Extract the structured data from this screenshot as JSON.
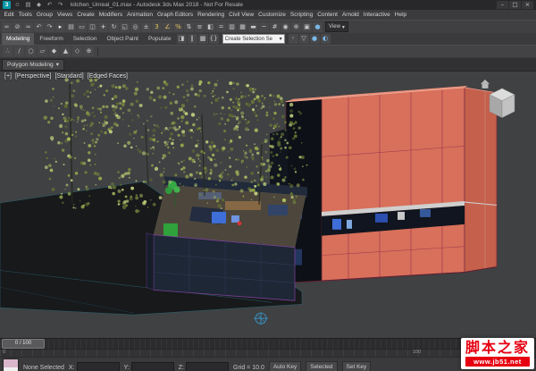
{
  "window": {
    "title": "kitchen_Unreal_01.max - Autodesk 3ds Max 2018 - Not For Resale",
    "logo": "3",
    "minimize": "–",
    "maximize": "□",
    "close": "×",
    "quick_icons": [
      {
        "name": "new-scene-icon",
        "glyph": "▫"
      },
      {
        "name": "open-file-icon",
        "glyph": "▤"
      },
      {
        "name": "save-file-icon",
        "glyph": "◆"
      },
      {
        "name": "undo-quick-icon",
        "glyph": "↶"
      },
      {
        "name": "redo-quick-icon",
        "glyph": "↷"
      }
    ]
  },
  "menu": {
    "items": [
      "Edit",
      "Tools",
      "Group",
      "Views",
      "Create",
      "Modifiers",
      "Animation",
      "Graph Editors",
      "Rendering",
      "Civil View",
      "Customize",
      "Scripting",
      "Content",
      "Arnold",
      "Interactive",
      "Help"
    ]
  },
  "toolbar": {
    "coord_dropdown": "View",
    "selection_set_value": "Create Selection Se",
    "icons": [
      {
        "name": "select-link-icon",
        "glyph": "∞"
      },
      {
        "name": "unlink-icon",
        "glyph": "⊘"
      },
      {
        "name": "bind-spacewarp-icon",
        "glyph": "≈"
      },
      {
        "name": "undo-icon",
        "glyph": "↶"
      },
      {
        "name": "redo-icon",
        "glyph": "↷"
      },
      {
        "name": "select-object-icon",
        "glyph": "▸",
        "color": "#f0f0f0"
      },
      {
        "name": "select-by-name-icon",
        "glyph": "▤"
      },
      {
        "name": "rectangular-region-icon",
        "glyph": "▭"
      },
      {
        "name": "window-crossing-icon",
        "glyph": "◫"
      },
      {
        "name": "select-move-icon",
        "glyph": "+",
        "color": "#e8e8e8"
      },
      {
        "name": "select-rotate-icon",
        "glyph": "↻"
      },
      {
        "name": "select-scale-icon",
        "glyph": "◱"
      },
      {
        "name": "pivot-point-icon",
        "glyph": "◎"
      },
      {
        "name": "select-manipulate-icon",
        "glyph": "±"
      },
      {
        "name": "snap-toggle-icon",
        "glyph": "3",
        "color": "#e2c25c"
      },
      {
        "name": "angle-snap-icon",
        "glyph": "∠",
        "color": "#e2c25c"
      },
      {
        "name": "percent-snap-icon",
        "glyph": "%",
        "color": "#e2c25c"
      },
      {
        "name": "spinner-snap-icon",
        "glyph": "⇅"
      },
      {
        "name": "named-selection-sets-icon",
        "glyph": "≡"
      },
      {
        "name": "mirror-icon",
        "glyph": "◧"
      },
      {
        "name": "align-icon",
        "glyph": "="
      },
      {
        "name": "scene-explorer-icon",
        "glyph": "▥"
      },
      {
        "name": "layer-explorer-icon",
        "glyph": "▦"
      },
      {
        "name": "ribbon-toggle-icon",
        "glyph": "▬"
      },
      {
        "name": "curve-editor-icon",
        "glyph": "~"
      },
      {
        "name": "schematic-view-icon",
        "glyph": "#"
      },
      {
        "name": "material-editor-icon",
        "glyph": "◉"
      },
      {
        "name": "render-setup-icon",
        "glyph": "⊕"
      },
      {
        "name": "rendered-frame-icon",
        "glyph": "▣"
      },
      {
        "name": "render-production-icon",
        "glyph": "●",
        "color": "#79b8e6"
      }
    ]
  },
  "ribbon": {
    "tabs": [
      {
        "name": "tab-modeling",
        "label": "Modeling",
        "active": true
      },
      {
        "name": "tab-freeform",
        "label": "Freeform"
      },
      {
        "name": "tab-selection",
        "label": "Selection"
      },
      {
        "name": "tab-object-paint",
        "label": "Object Paint"
      },
      {
        "name": "tab-populate",
        "label": "Populate"
      }
    ],
    "row2_icons": [
      {
        "name": "mirror-tool-icon",
        "glyph": "◨"
      },
      {
        "name": "align-tool-icon",
        "glyph": "∥"
      },
      {
        "name": "grid-snap-icon",
        "glyph": "▩"
      },
      {
        "name": "sets-icon",
        "glyph": "{}"
      }
    ],
    "row2_icons_b": [
      {
        "name": "isolate-selection-icon",
        "glyph": "◦"
      },
      {
        "name": "display-filter-icon",
        "glyph": "▽"
      },
      {
        "name": "render-teapot-icon",
        "glyph": "●",
        "color": "#79b8e6"
      },
      {
        "name": "arnold-render-icon",
        "glyph": "◐",
        "color": "#79b8e6"
      }
    ],
    "panel_icons": [
      {
        "name": "vertex-sub-icon",
        "glyph": "∴"
      },
      {
        "name": "edge-sub-icon",
        "glyph": "∕"
      },
      {
        "name": "border-sub-icon",
        "glyph": "○"
      },
      {
        "name": "polygon-sub-icon",
        "glyph": "▱"
      },
      {
        "name": "element-sub-icon",
        "glyph": "◆"
      },
      {
        "name": "modify-mode-icon",
        "glyph": "▲"
      },
      {
        "name": "constraints-icon",
        "glyph": "◇"
      },
      {
        "name": "symmetry-icon",
        "glyph": "⊕"
      }
    ],
    "panel_label": "Polygon Modeling",
    "panel_arrow": "▾"
  },
  "viewport": {
    "menu_plus": "[+]",
    "menu_pov": "[Perspective]",
    "menu_preset": "[Standard]",
    "menu_shading": "[Edged Faces]"
  },
  "timeline": {
    "handle": "0 / 100",
    "start": "0",
    "end": "100"
  },
  "status": {
    "selection": "None Selected",
    "x_label": "X:",
    "y_label": "Y:",
    "z_label": "Z:",
    "x_value": "",
    "y_value": "",
    "z_value": "",
    "grid": "Grid = 10.0",
    "auto_key": "Auto Key",
    "selected_mode": "Selected",
    "set_key": "Set Key"
  },
  "watermark": {
    "title": "脚本之家",
    "url": "www.jb51.net",
    "accent": "#e60012"
  },
  "scene": {
    "colors": {
      "viewport_bg": "#3f4143",
      "ground": "#17191b",
      "ground_edge": "#2e5e6a",
      "building_front": "#d8705b",
      "building_side": "#c4604c",
      "building_top": "#e8907c",
      "building_opening": "#0d1016",
      "band_light": "#cfcfcf",
      "window_strip": "#10151f",
      "edge_magenta": "#a03a50",
      "kitchen_wall": "#1e2736",
      "kitchen_floor": "#4c463c",
      "kitchen_edge": "#7a4098",
      "accent_blue": "#3e6fd8",
      "accent_green": "#2fa23c",
      "foliage": [
        "#c2cf7e",
        "#a9b95f",
        "#90a14b",
        "#75843c",
        "#5f6c31"
      ]
    }
  }
}
